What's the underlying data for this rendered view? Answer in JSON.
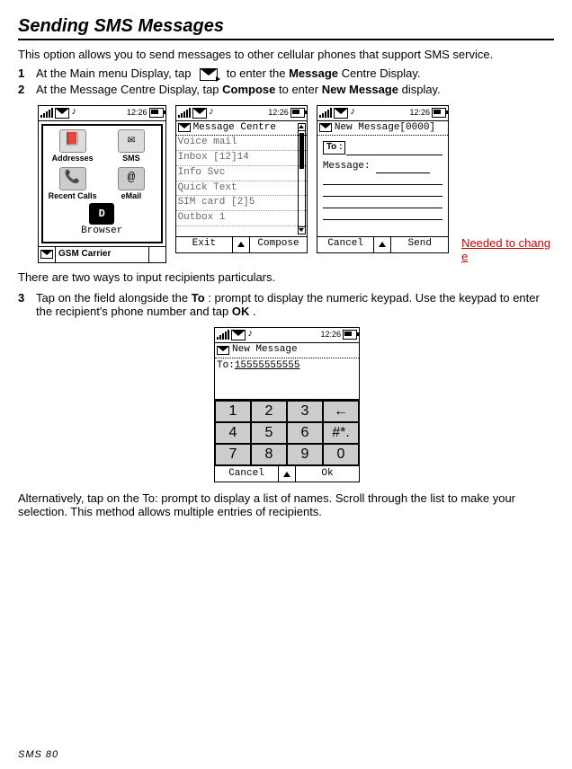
{
  "title": "Sending SMS Messages",
  "intro": "This option allows you to send messages to other cellular phones that support SMS service.",
  "steps12": [
    {
      "n": "1",
      "pre": "At the Main menu Display, tap",
      "post": " to enter the ",
      "b1": "Message",
      "mid": " Centre  Display."
    },
    {
      "n": "2",
      "pre": "At the Message Centre Display, tap ",
      "b1": "Compose",
      "mid": "  to enter  ",
      "b2": "New Message",
      "end": " display."
    }
  ],
  "status_time": "12:26",
  "screen1": {
    "grid": [
      {
        "icon": "📕",
        "label": "Addresses"
      },
      {
        "icon": "✉",
        "label": "SMS"
      },
      {
        "icon": "📞",
        "label": "Recent Calls"
      },
      {
        "icon": "@",
        "label": "eMail"
      }
    ],
    "browser_label": "Browser",
    "browser_icon": "D",
    "footer": "GSM Carrier"
  },
  "screen2": {
    "title": "Message Centre",
    "items": [
      "Voice mail",
      "Inbox     [12]14",
      "Info Svc",
      "Quick Text",
      "SIM card   [2]5",
      "Outbox        1"
    ],
    "left": "Exit",
    "right": "Compose"
  },
  "screen3": {
    "title": "New Message[0000]",
    "to_label": "To :",
    "msg_label": "Message:",
    "left": "Cancel",
    "right": "Send"
  },
  "redline": "Needed to chang  e",
  "after_row": "There are two ways to input recipients particulars.",
  "step3": {
    "n": "3",
    "pre": "Tap on the field alongside the ",
    "b1": "To",
    "mid": ": prompt to display the numeric keypad. Use the keypad to enter the recipient's phone number and tap ",
    "b2": "OK",
    "end": "."
  },
  "screen4": {
    "title": "New Message",
    "to_prefix": "To:",
    "to_value": "15555555555",
    "keys": [
      [
        "1",
        "2",
        "3",
        "←"
      ],
      [
        "4",
        "5",
        "6",
        "#*."
      ],
      [
        "7",
        "8",
        "9",
        "0"
      ]
    ],
    "left": "Cancel",
    "right": "Ok"
  },
  "alt_text": "Alternatively, tap on the To: prompt to display a list of names. Scroll through the list to make your selection. This method allows multiple entries of recipients.",
  "footer": "SMS   80"
}
